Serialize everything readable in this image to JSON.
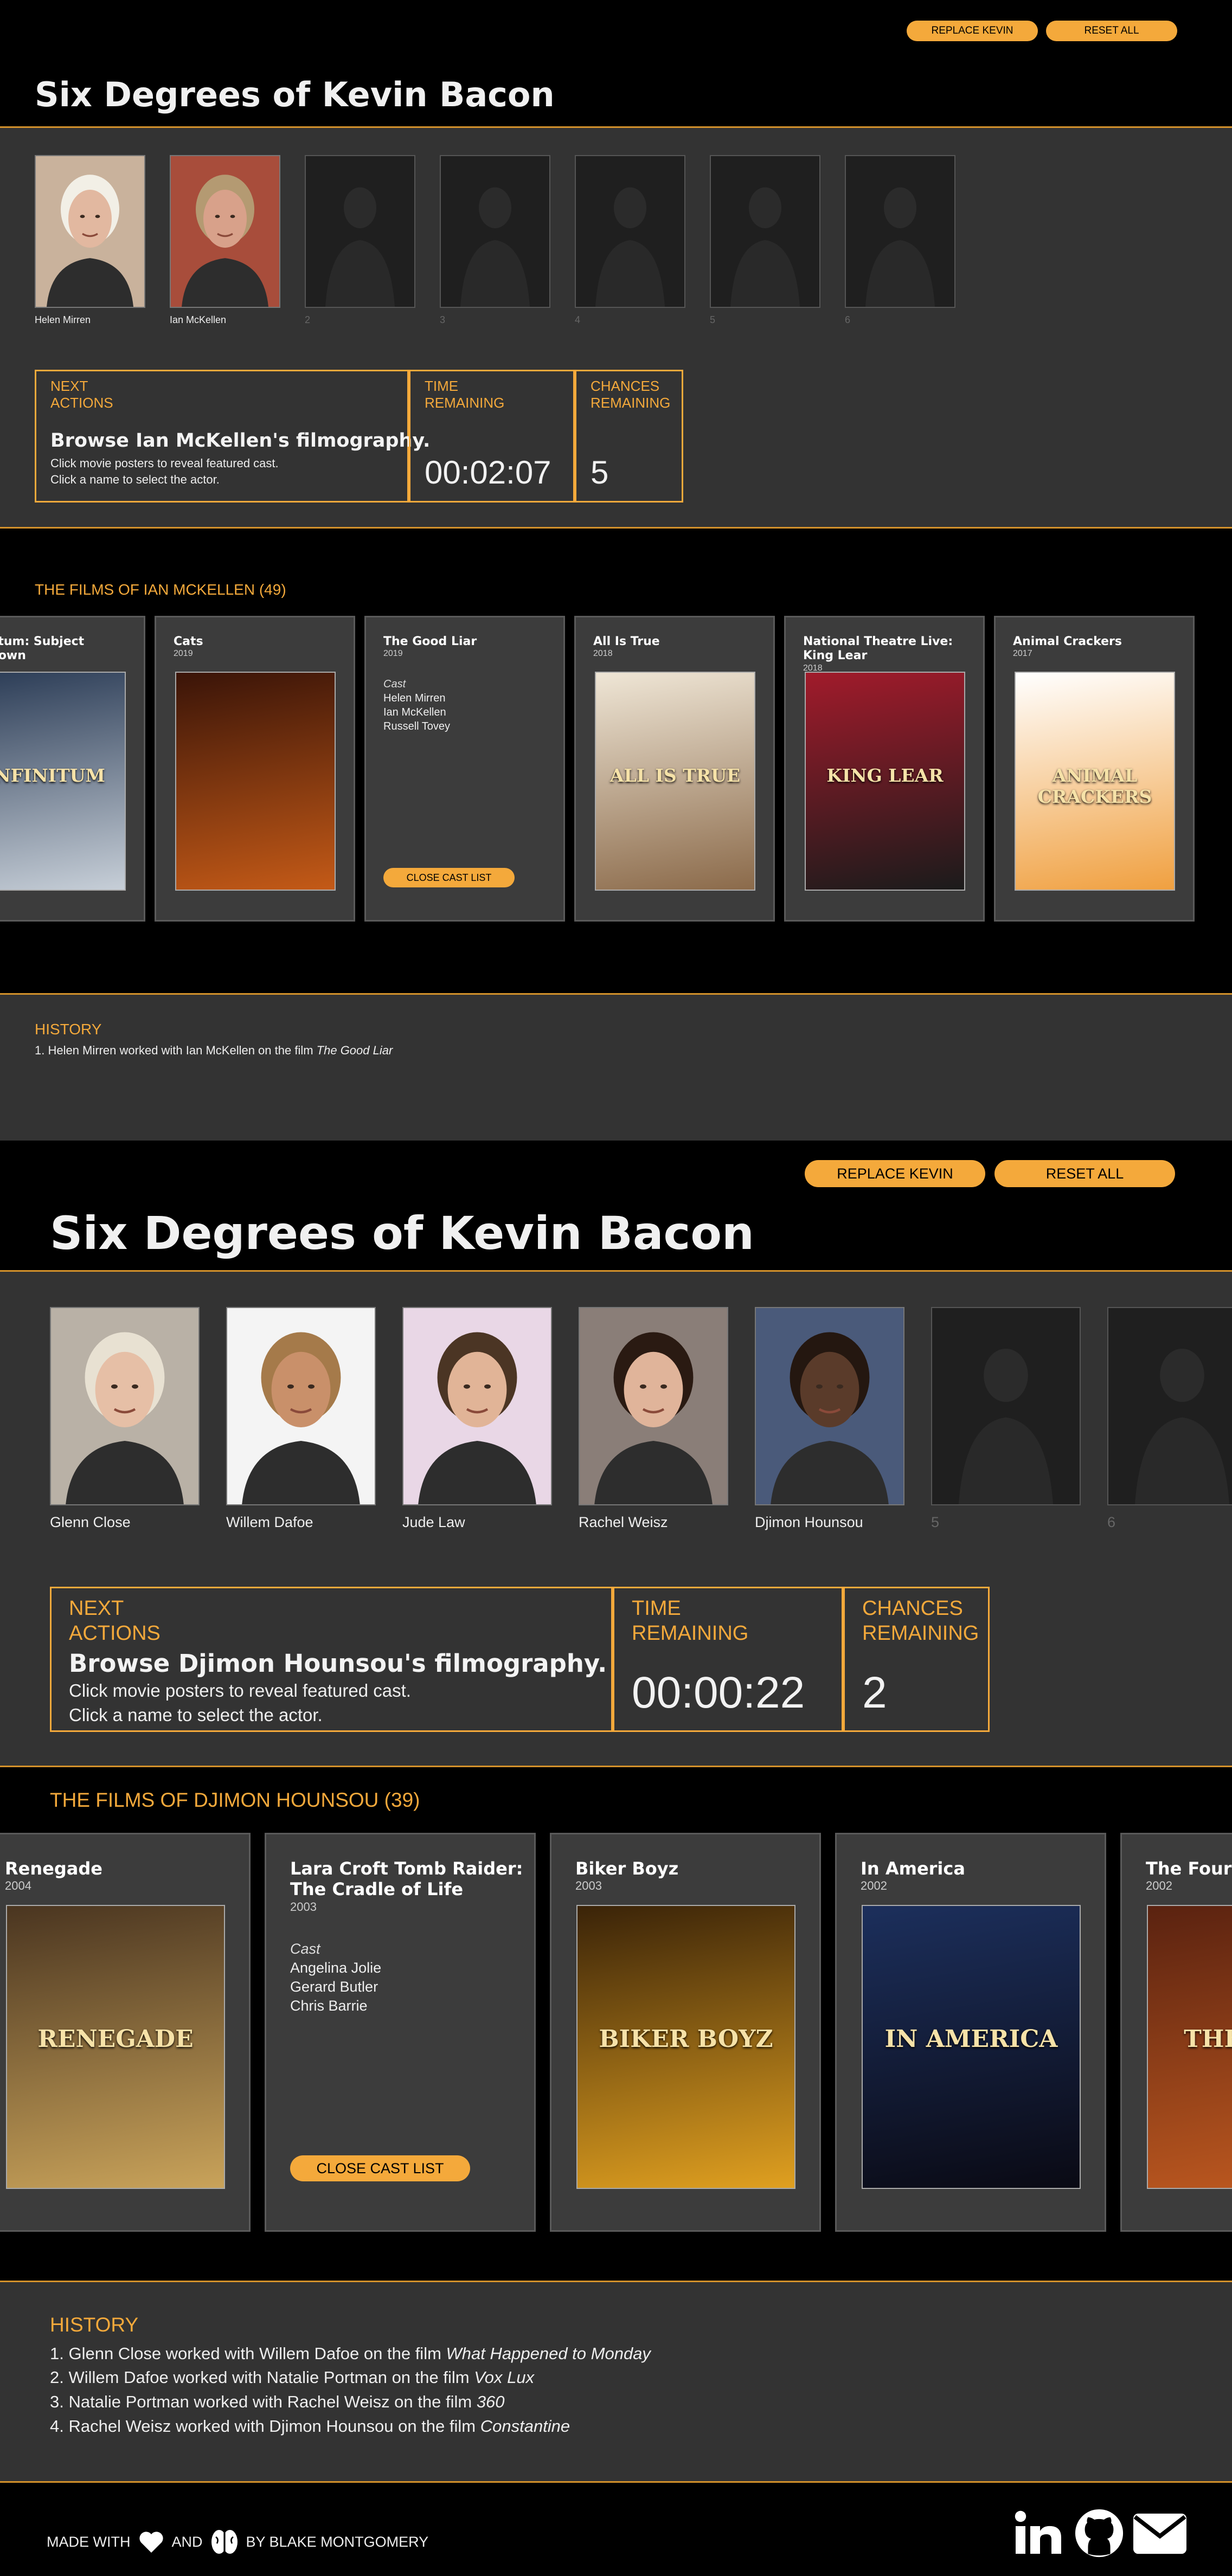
{
  "top": {
    "buttons": {
      "replace": "REPLACE KEVIN",
      "reset": "RESET ALL"
    },
    "title": "Six Degrees of Kevin Bacon",
    "chain": [
      {
        "name": "Helen Mirren",
        "filled": true,
        "skin": "#e2b8a0",
        "hair": "#f2efe6",
        "bg": "#c9b29c"
      },
      {
        "name": "Ian McKellen",
        "filled": true,
        "skin": "#d8a18a",
        "hair": "#b49a72",
        "bg": "#a84d3b"
      },
      {
        "name": "2",
        "filled": false
      },
      {
        "name": "3",
        "filled": false
      },
      {
        "name": "4",
        "filled": false
      },
      {
        "name": "5",
        "filled": false
      },
      {
        "name": "6",
        "filled": false
      }
    ],
    "next": {
      "label1": "NEXT",
      "label2": "ACTIONS",
      "headline": "Browse Ian McKellen's filmography.",
      "line1": "Click movie posters to reveal featured cast.",
      "line2": "Click a name to select the actor."
    },
    "time": {
      "label1": "TIME",
      "label2": "REMAINING",
      "value": "00:02:07"
    },
    "chances": {
      "label1": "CHANCES",
      "label2": "REMAINING",
      "value": "5"
    },
    "films_heading": "THE FILMS OF IAN MCKELLEN (49)",
    "films": [
      {
        "title1": "Infinitum: Subject",
        "title2": "Unknown",
        "year": "",
        "poster": [
          "#2a3b55",
          "#c7cfd8"
        ],
        "poster_text": "INFINITUM"
      },
      {
        "title1": "Cats",
        "title2": "",
        "year": "2019",
        "poster": [
          "#3a1408",
          "#c45a17"
        ],
        "poster_text": ""
      },
      {
        "title1": "The Good Liar",
        "title2": "",
        "year": "2019",
        "cast_open": true,
        "cast_label": "Cast",
        "cast": [
          "Helen Mirren",
          "Ian McKellen",
          "Russell Tovey"
        ],
        "close": "CLOSE CAST LIST"
      },
      {
        "title1": "All Is True",
        "title2": "",
        "year": "2018",
        "poster": [
          "#efe6d6",
          "#8b6a4a"
        ],
        "poster_text": "ALL IS TRUE"
      },
      {
        "title1": "National Theatre Live:",
        "title2": "King Lear",
        "year": "2018",
        "poster": [
          "#a11b2b",
          "#1b1b1b"
        ],
        "poster_text": "KING LEAR"
      },
      {
        "title1": "Animal Crackers",
        "title2": "",
        "year": "2017",
        "poster": [
          "#ffffff",
          "#f0a040"
        ],
        "poster_text": "ANIMAL CRACKERS"
      }
    ],
    "history_label": "HISTORY",
    "history": [
      {
        "text": "1. Helen Mirren worked with Ian McKellen on the film ",
        "film": "The Good Liar"
      }
    ]
  },
  "bottom": {
    "buttons": {
      "replace": "REPLACE KEVIN",
      "reset": "RESET ALL"
    },
    "title": "Six Degrees of Kevin Bacon",
    "chain": [
      {
        "name": "Glenn Close",
        "filled": true,
        "skin": "#e6bfa6",
        "hair": "#e8e1d2",
        "bg": "#b9b1a6"
      },
      {
        "name": "Willem Dafoe",
        "filled": true,
        "skin": "#c9906a",
        "hair": "#a57a4a",
        "bg": "#f4f4f4"
      },
      {
        "name": "Jude Law",
        "filled": true,
        "skin": "#e1b497",
        "hair": "#4b3524",
        "bg": "#e9d7e6"
      },
      {
        "name": "Rachel Weisz",
        "filled": true,
        "skin": "#e0b49a",
        "hair": "#2a1a12",
        "bg": "#8a7e78"
      },
      {
        "name": "Djimon Hounsou",
        "filled": true,
        "skin": "#5a3b2a",
        "hair": "#241710",
        "bg": "#4a5a7a"
      },
      {
        "name": "5",
        "filled": false
      },
      {
        "name": "6",
        "filled": false
      }
    ],
    "next": {
      "label1": "NEXT",
      "label2": "ACTIONS",
      "headline": "Browse Djimon Hounsou's filmography.",
      "line1": "Click movie posters to reveal featured cast.",
      "line2": "Click a name to select the actor."
    },
    "time": {
      "label1": "TIME",
      "label2": "REMAINING",
      "value": "00:00:22"
    },
    "chances": {
      "label1": "CHANCES",
      "label2": "REMAINING",
      "value": "2"
    },
    "films_heading": "THE FILMS OF DJIMON HOUNSOU (39)",
    "films": [
      {
        "title1": "Renegade",
        "title2": "",
        "year": "2004",
        "poster": [
          "#4a3520",
          "#c9a35a"
        ],
        "poster_text": "RENEGADE"
      },
      {
        "title1": "Lara Croft Tomb Raider:",
        "title2": "The Cradle of Life",
        "year": "2003",
        "cast_open": true,
        "cast_label": "Cast",
        "cast": [
          "Angelina Jolie",
          "Gerard Butler",
          "Chris Barrie"
        ],
        "close": "CLOSE CAST LIST"
      },
      {
        "title1": "Biker Boyz",
        "title2": "",
        "year": "2003",
        "poster": [
          "#3a2308",
          "#e0a020"
        ],
        "poster_text": "BIKER BOYZ"
      },
      {
        "title1": "In America",
        "title2": "",
        "year": "2002",
        "poster": [
          "#1c2f5c",
          "#0a0a14"
        ],
        "poster_text": "IN AMERICA"
      },
      {
        "title1": "The Four Feathers",
        "title2": "",
        "year": "2002",
        "poster": [
          "#5a2210",
          "#c05a20"
        ],
        "poster_text": "THE FOUR"
      }
    ],
    "history_label": "HISTORY",
    "history": [
      {
        "text": "1. Glenn Close worked with Willem Dafoe on the film ",
        "film": "What Happened to Monday"
      },
      {
        "text": "2. Willem Dafoe worked with Natalie Portman on the film ",
        "film": "Vox Lux"
      },
      {
        "text": "3. Natalie Portman worked with Rachel Weisz on the film ",
        "film": "360"
      },
      {
        "text": "4. Rachel Weisz worked with Djimon Hounsou on the film ",
        "film": "Constantine"
      }
    ],
    "footer": {
      "made": "MADE WITH",
      "and": "AND",
      "by": "BY BLAKE MONTGOMERY",
      "icons": [
        "heart-icon",
        "brain-icon",
        "linkedin-icon",
        "github-icon",
        "mail-icon"
      ]
    }
  },
  "colors": {
    "accent": "#f4a93b",
    "panel": "#333333",
    "card": "#3c3c3c"
  }
}
